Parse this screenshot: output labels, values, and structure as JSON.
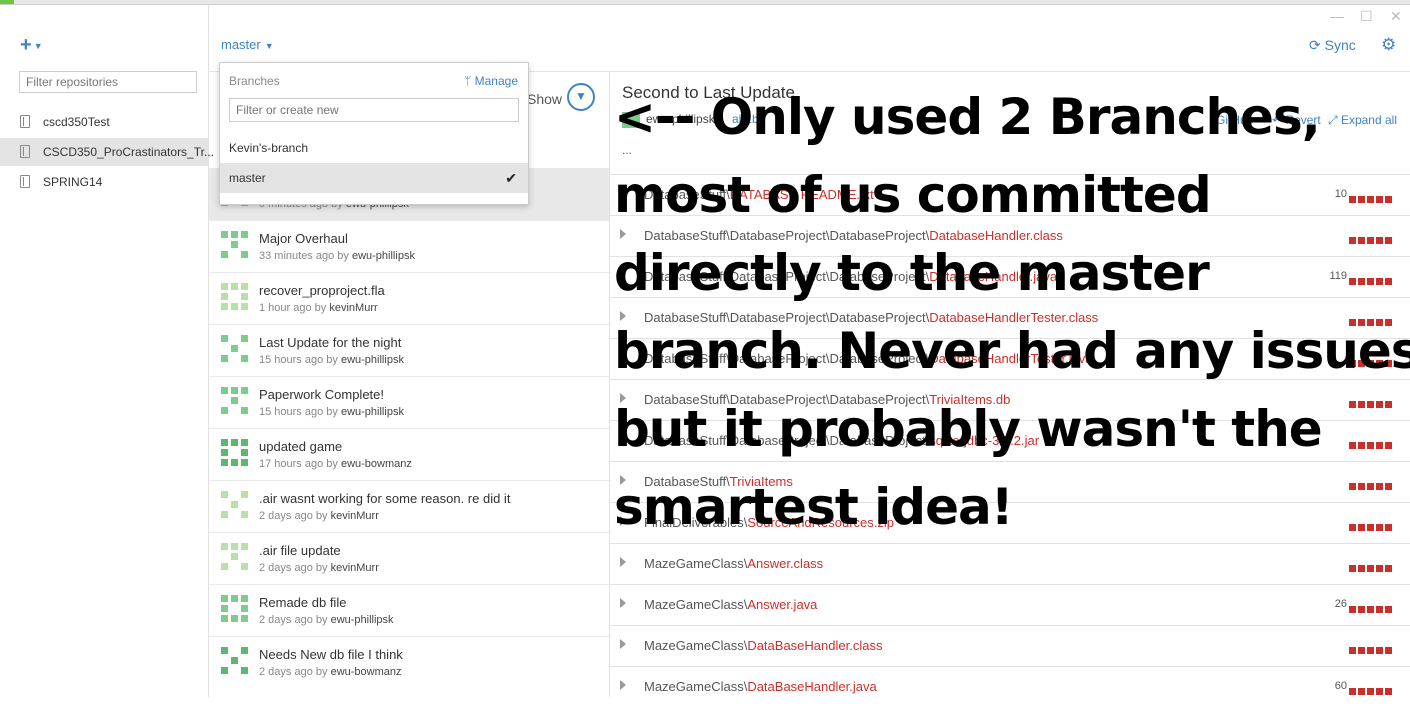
{
  "sidebar": {
    "filter_placeholder": "Filter repositories",
    "repos": [
      {
        "name": "cscd350Test",
        "selected": false
      },
      {
        "name": "CSCD350_ProCrastinators_Tr...",
        "selected": true
      },
      {
        "name": "SPRING14",
        "selected": false
      }
    ]
  },
  "header": {
    "branch": "master",
    "sync_label": "Sync"
  },
  "branch_dropdown": {
    "title": "Branches",
    "manage_label": "Manage",
    "filter_placeholder": "Filter or create new",
    "items": [
      {
        "label": "Kevin's-branch",
        "selected": false
      },
      {
        "label": "master",
        "selected": true
      }
    ]
  },
  "commit_list": {
    "show_label": "Show",
    "commits": [
      {
        "title": "",
        "time": "9 minutes ago",
        "author": "ewu-phillipsk",
        "selected": true
      },
      {
        "title": "Major Overhaul",
        "time": "33 minutes ago",
        "author": "ewu-phillipsk",
        "selected": false
      },
      {
        "title": "recover_proproject.fla",
        "time": "1 hour ago",
        "author": "kevinMurr",
        "selected": false
      },
      {
        "title": "Last Update for the night",
        "time": "15 hours ago",
        "author": "ewu-phillipsk",
        "selected": false
      },
      {
        "title": "Paperwork Complete!",
        "time": "15 hours ago",
        "author": "ewu-phillipsk",
        "selected": false
      },
      {
        "title": "updated game",
        "time": "17 hours ago",
        "author": "ewu-bowmanz",
        "selected": false
      },
      {
        "title": ".air wasnt working for some reason. re did it",
        "time": "2 days ago",
        "author": "kevinMurr",
        "selected": false
      },
      {
        "title": ".air file update",
        "time": "2 days ago",
        "author": "kevinMurr",
        "selected": false
      },
      {
        "title": "Remade db file",
        "time": "2 days ago",
        "author": "ewu-phillipsk",
        "selected": false
      },
      {
        "title": "Needs New db file I think",
        "time": "2 days ago",
        "author": "ewu-bowmanz",
        "selected": false
      }
    ],
    "by_word": "by"
  },
  "detail": {
    "title": "Second to Last Update",
    "author": "ewu-phillipsk",
    "sha": "ab1b3",
    "github_label": "GitHub",
    "revert_label": "Revert",
    "expand_label": "Expand all",
    "ellipsis": "...",
    "files": [
      {
        "dir": "DatabaseStuff\\",
        "name": "DATABASE README.txt",
        "count": "10"
      },
      {
        "dir": "DatabaseStuff\\DatabaseProject\\DatabaseProject\\",
        "name": "DatabaseHandler.class",
        "count": ""
      },
      {
        "dir": "DatabaseStuff\\DatabaseProject\\DatabaseProject\\",
        "name": "DatabaseHandler.java",
        "count": "119"
      },
      {
        "dir": "DatabaseStuff\\DatabaseProject\\DatabaseProject\\",
        "name": "DatabaseHandlerTester.class",
        "count": ""
      },
      {
        "dir": "DatabaseStuff\\DatabaseProject\\DatabaseProject\\",
        "name": "DatabaseHandlerTester.java",
        "count": ""
      },
      {
        "dir": "DatabaseStuff\\DatabaseProject\\DatabaseProject\\",
        "name": "TriviaItems.db",
        "count": ""
      },
      {
        "dir": "DatabaseStuff\\DatabaseProject\\DatabaseProject\\",
        "name": "sqlite-jdbc-3.7.2.jar",
        "count": ""
      },
      {
        "dir": "DatabaseStuff\\",
        "name": "TriviaItems",
        "count": ""
      },
      {
        "dir": "FinalDeliverables\\",
        "name": "SourceAndResources.zip",
        "count": ""
      },
      {
        "dir": "MazeGameClass\\",
        "name": "Answer.class",
        "count": ""
      },
      {
        "dir": "MazeGameClass\\",
        "name": "Answer.java",
        "count": "26"
      },
      {
        "dir": "MazeGameClass\\",
        "name": "DataBaseHandler.class",
        "count": ""
      },
      {
        "dir": "MazeGameClass\\",
        "name": "DataBaseHandler.java",
        "count": "60"
      }
    ]
  },
  "annotation": {
    "lines": [
      "<-- Only used 2 Branches,",
      "most of us committed",
      "directly to the master",
      "branch. Never had any issues",
      "but it probably wasn't the",
      "smartest idea!"
    ]
  },
  "colors": {
    "accent": "#4183c4",
    "deletion": "#c9302c",
    "avatar_green": "#7dcc8c"
  }
}
